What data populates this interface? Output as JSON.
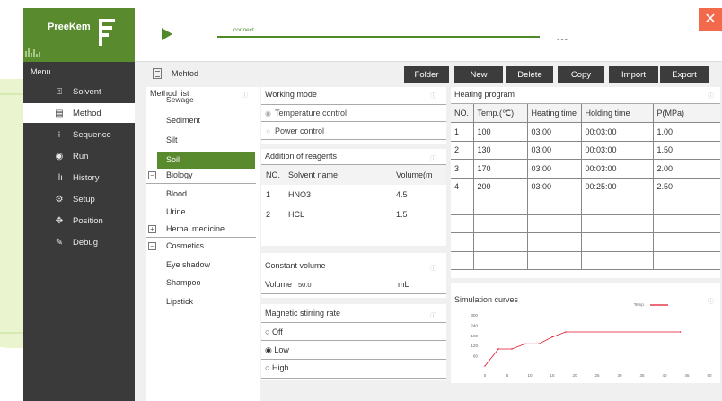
{
  "app": {
    "logo_text": "PreeKem",
    "menu_title": "Menu",
    "close_label": "✕"
  },
  "sidebar": {
    "items": [
      {
        "label": "Solvent",
        "icon": "solvent-icon",
        "glyph": "⍐"
      },
      {
        "label": "Method",
        "icon": "method-icon",
        "glyph": "▤"
      },
      {
        "label": "Sequence",
        "icon": "sequence-icon",
        "glyph": "⁝"
      },
      {
        "label": "Run",
        "icon": "run-icon",
        "glyph": "◉"
      },
      {
        "label": "History",
        "icon": "history-icon",
        "glyph": "ılı"
      },
      {
        "label": "Setup",
        "icon": "setup-icon",
        "glyph": "⚙"
      },
      {
        "label": "Position",
        "icon": "position-icon",
        "glyph": "✥"
      },
      {
        "label": "Debug",
        "icon": "debug-icon",
        "glyph": "✎"
      }
    ],
    "active": "Method"
  },
  "topbar": {
    "connect_label": "connect",
    "status": "---"
  },
  "toolbar": {
    "page_title": "Mehtod",
    "buttons": {
      "folder": "Folder",
      "new": "New",
      "delete": "Delete",
      "copy": "Copy",
      "import": "Import",
      "export": "Export"
    }
  },
  "method_list": {
    "title": "Method list",
    "top_items": [
      "Sewage",
      "Sediment",
      "Silt"
    ],
    "selected": "Soil",
    "groups": [
      {
        "label": "Biology",
        "toggle": "−",
        "children": [
          "Blood",
          "Urine"
        ]
      },
      {
        "label": "Herbal medicine",
        "toggle": "+",
        "children": []
      },
      {
        "label": "Cosmetics",
        "toggle": "−",
        "children": [
          "Eye shadow",
          "Shampoo",
          "Lipstick"
        ]
      }
    ]
  },
  "working_mode": {
    "title": "Working mode",
    "options": [
      "Temperature control",
      "Power control"
    ]
  },
  "reagents": {
    "title": "Addition of reagents",
    "columns": [
      "NO.",
      "Solvent name",
      "Volume(m"
    ],
    "rows": [
      [
        "1",
        "HNO3",
        "4.5"
      ],
      [
        "2",
        "HCL",
        "1.5"
      ]
    ]
  },
  "constant_volume": {
    "title": "Constant volume",
    "label": "Volume",
    "value": "50.0",
    "unit": "mL"
  },
  "stirring": {
    "title": "Magnetic stirring rate",
    "options": [
      {
        "label": "Off",
        "mark": "○"
      },
      {
        "label": "Low",
        "mark": "◉"
      },
      {
        "label": "High",
        "mark": "○"
      }
    ]
  },
  "heating": {
    "title": "Heating program",
    "columns": [
      "NO.",
      "Temp.(℃)",
      "Heating time",
      "Holding time",
      "P(MPa)"
    ],
    "rows": [
      [
        "1",
        "100",
        "03:00",
        "00:03:00",
        "1.00"
      ],
      [
        "2",
        "130",
        "03:00",
        "00:03:00",
        "1.50"
      ],
      [
        "3",
        "170",
        "03:00",
        "00:03:00",
        "2.00"
      ],
      [
        "4",
        "200",
        "03:00",
        "00:25:00",
        "2.50"
      ],
      [
        "",
        "",
        "",
        "",
        ""
      ],
      [
        "",
        "",
        "",
        "",
        ""
      ],
      [
        "",
        "",
        "",
        "",
        ""
      ],
      [
        "",
        "",
        "",
        "",
        ""
      ]
    ]
  },
  "chart_data": {
    "type": "line",
    "title": "Simulation curves",
    "series": [
      {
        "name": "Temp.",
        "color": "#e0142c",
        "x": [
          0,
          3,
          6,
          9,
          12,
          15,
          18,
          43.5
        ],
        "y": [
          0,
          100,
          100,
          130,
          130,
          170,
          200,
          200
        ]
      }
    ],
    "x_ticks": [
      "0",
      "5",
      "10",
      "15",
      "20",
      "25",
      "30",
      "35",
      "40",
      "45",
      "50"
    ],
    "y_ticks": [
      "300",
      "240",
      "180",
      "120",
      "60"
    ],
    "xlim": [
      0,
      50
    ],
    "ylim": [
      0,
      300
    ],
    "legend": "top-right"
  }
}
